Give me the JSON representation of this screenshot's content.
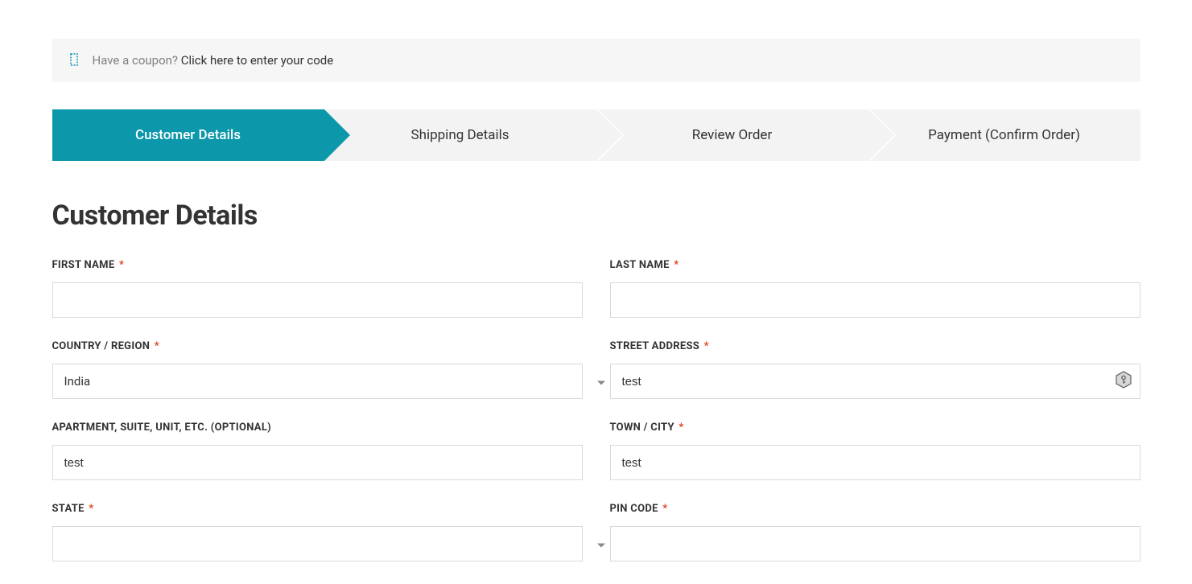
{
  "coupon": {
    "question": "Have a coupon?",
    "link_text": "Click here to enter your code"
  },
  "steps": [
    {
      "label": "Customer Details",
      "active": true
    },
    {
      "label": "Shipping Details",
      "active": false
    },
    {
      "label": "Review Order",
      "active": false
    },
    {
      "label": "Payment (Confirm Order)",
      "active": false
    }
  ],
  "page_heading": "Customer Details",
  "fields": {
    "first_name": {
      "label": "FIRST NAME",
      "required": true,
      "value": ""
    },
    "last_name": {
      "label": "LAST NAME",
      "required": true,
      "value": ""
    },
    "country": {
      "label": "COUNTRY / REGION",
      "required": true,
      "value": "India"
    },
    "street_address": {
      "label": "STREET ADDRESS",
      "required": true,
      "value": "test"
    },
    "apartment": {
      "label": "APARTMENT, SUITE, UNIT, ETC. (OPTIONAL)",
      "required": false,
      "value": "test"
    },
    "town_city": {
      "label": "TOWN / CITY",
      "required": true,
      "value": "test"
    },
    "state": {
      "label": "STATE",
      "required": true,
      "value": ""
    },
    "pin_code": {
      "label": "PIN CODE",
      "required": true,
      "value": ""
    }
  },
  "required_marker": "*"
}
